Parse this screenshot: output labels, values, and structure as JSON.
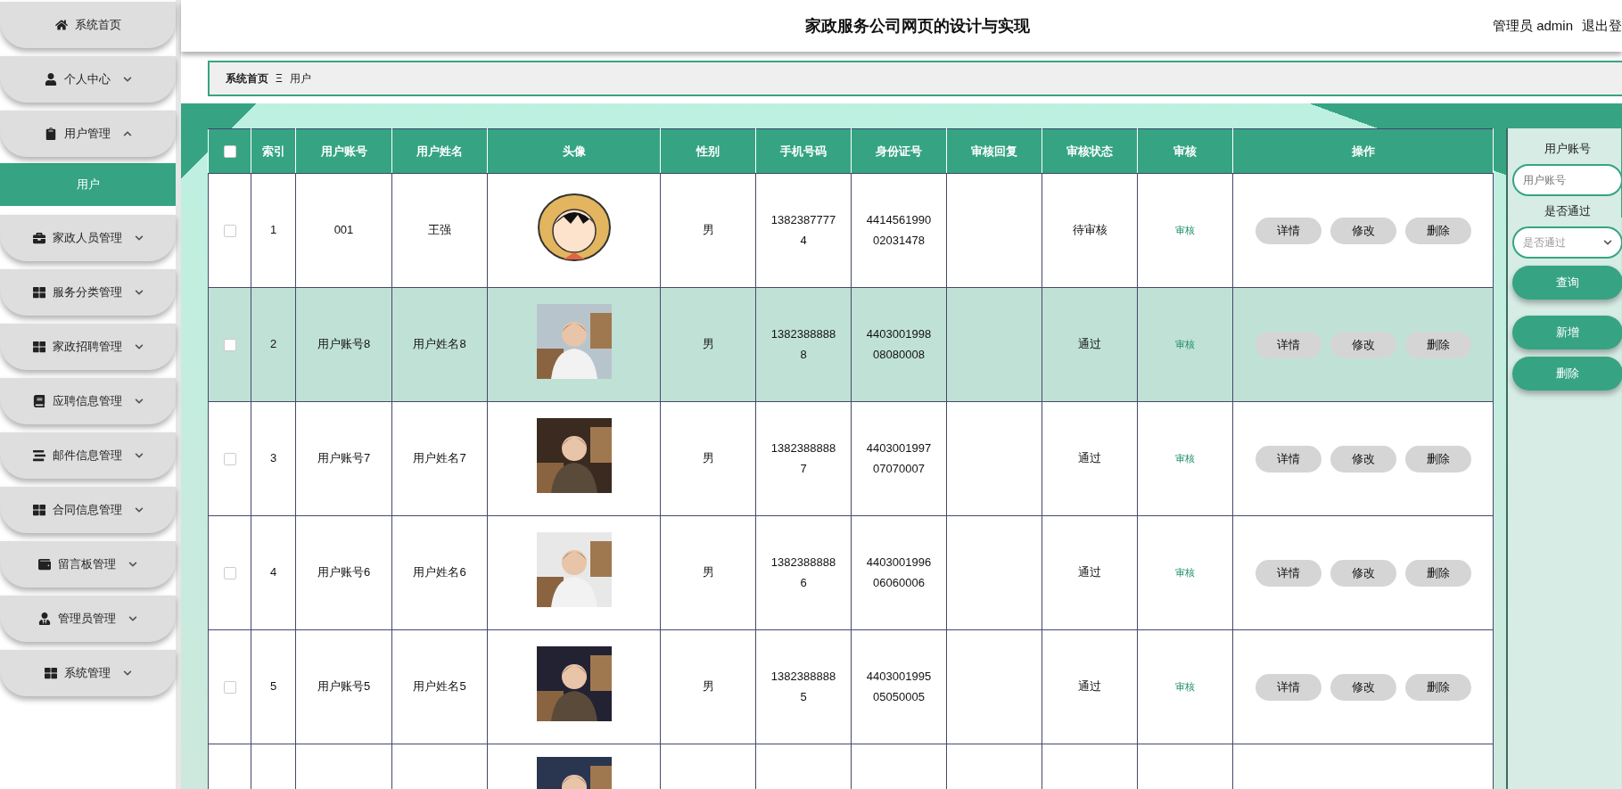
{
  "header": {
    "title": "家政服务公司网页的设计与实现",
    "user": "管理员 admin",
    "logout": "退出登"
  },
  "sidebar": {
    "items": [
      {
        "label": "系统首页",
        "kind": "link"
      },
      {
        "label": "个人中心",
        "kind": "menu",
        "expanded": false
      },
      {
        "label": "用户管理",
        "kind": "menu",
        "expanded": true,
        "children": [
          {
            "label": "用户",
            "selected": true
          }
        ]
      },
      {
        "label": "家政人员管理",
        "kind": "menu",
        "expanded": false
      },
      {
        "label": "服务分类管理",
        "kind": "menu",
        "expanded": false
      },
      {
        "label": "家政招聘管理",
        "kind": "menu",
        "expanded": false
      },
      {
        "label": "应聘信息管理",
        "kind": "menu",
        "expanded": false
      },
      {
        "label": "邮件信息管理",
        "kind": "menu",
        "expanded": false
      },
      {
        "label": "合同信息管理",
        "kind": "menu",
        "expanded": false
      },
      {
        "label": "留言板管理",
        "kind": "menu",
        "expanded": false
      },
      {
        "label": "管理员管理",
        "kind": "menu",
        "expanded": false
      },
      {
        "label": "系统管理",
        "kind": "menu",
        "expanded": false
      }
    ]
  },
  "breadcrumb": {
    "home": "系统首页",
    "separator": "Ξ",
    "current": "用户"
  },
  "table": {
    "select_all": {
      "checked": false
    },
    "columns": [
      "索引",
      "用户账号",
      "用户姓名",
      "头像",
      "性别",
      "手机号码",
      "身份证号",
      "审核回复",
      "审核状态",
      "审核",
      "操作"
    ],
    "rows": [
      {
        "checked": false,
        "selected": false,
        "index": "1",
        "account": "001",
        "name": "王强",
        "gender": "男",
        "phone": "13823877774",
        "id_number": "441456199002031478",
        "status": "待审核",
        "review": "审核",
        "actions": [
          "详情",
          "修改",
          "删除"
        ]
      },
      {
        "checked": false,
        "selected": true,
        "index": "2",
        "account": "用户账号8",
        "name": "用户姓名8",
        "gender": "男",
        "phone": "13823888888",
        "id_number": "440300199808080008",
        "status": "通过",
        "review": "审核",
        "actions": [
          "详情",
          "修改",
          "删除"
        ]
      },
      {
        "checked": false,
        "selected": false,
        "index": "3",
        "account": "用户账号7",
        "name": "用户姓名7",
        "gender": "男",
        "phone": "13823888887",
        "id_number": "440300199707070007",
        "status": "通过",
        "review": "审核",
        "actions": [
          "详情",
          "修改",
          "删除"
        ]
      },
      {
        "checked": false,
        "selected": false,
        "index": "4",
        "account": "用户账号6",
        "name": "用户姓名6",
        "gender": "男",
        "phone": "13823888886",
        "id_number": "440300199606060006",
        "status": "通过",
        "review": "审核",
        "actions": [
          "详情",
          "修改",
          "删除"
        ]
      },
      {
        "checked": false,
        "selected": false,
        "index": "5",
        "account": "用户账号5",
        "name": "用户姓名5",
        "gender": "男",
        "phone": "13823888885",
        "id_number": "440300199505050005",
        "status": "通过",
        "review": "审核",
        "actions": [
          "详情",
          "修改",
          "删除"
        ]
      },
      {
        "selected": false
      }
    ]
  },
  "search": {
    "account_label": "用户账号",
    "account_placeholder": "用户账号",
    "pass_label": "是否通过",
    "pass_placeholder": "是否通过",
    "buttons": [
      "查询",
      "新增",
      "删除"
    ]
  }
}
